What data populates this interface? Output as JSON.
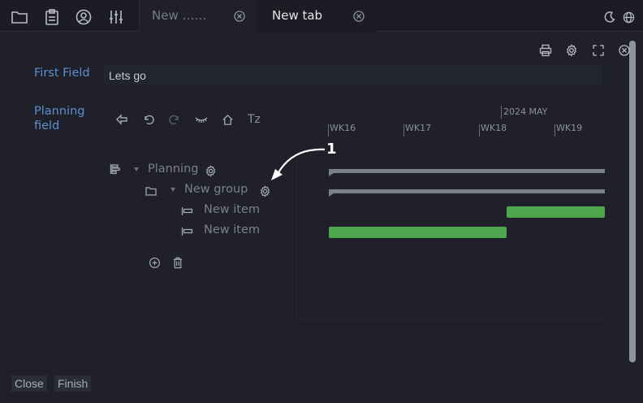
{
  "tabs": [
    {
      "label": "New ……",
      "active": false
    },
    {
      "label": "New tab",
      "active": true
    }
  ],
  "form": {
    "first_field_label": "First Field",
    "first_field_value": "Lets go",
    "planning_label_line1": "Planning",
    "planning_label_line2": "field"
  },
  "gantt": {
    "tz_label": "Tz",
    "month_label": "2024  MAY",
    "weeks": [
      "WK16",
      "WK17",
      "WK18",
      "WK19"
    ],
    "tree": [
      {
        "label": "Planning",
        "type": "planning"
      },
      {
        "label": "New group",
        "type": "group"
      },
      {
        "label": "New item",
        "type": "item"
      },
      {
        "label": "New item",
        "type": "item"
      }
    ]
  },
  "annotation": {
    "number": "1"
  },
  "footer": {
    "close_label": "Close",
    "finish_label": "Finish"
  },
  "colors": {
    "accent_label": "#5b8fcf",
    "bar_green": "#4fa64c",
    "bar_gray": "#7d7f86"
  }
}
